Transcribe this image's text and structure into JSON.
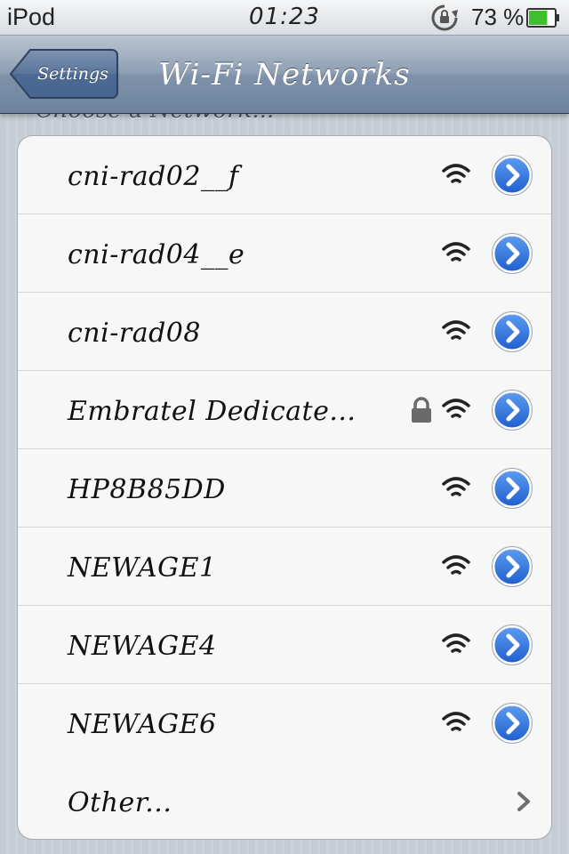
{
  "status_bar": {
    "carrier": "iPod",
    "time": "01:23",
    "battery_percent": "73 %",
    "battery_level": 0.73
  },
  "nav": {
    "back_label": "Settings",
    "title": "Wi-Fi Networks"
  },
  "section_header": "Choose a Network...",
  "networks": [
    {
      "name": "cni-rad02__f",
      "secured": false
    },
    {
      "name": "cni-rad04__e",
      "secured": false
    },
    {
      "name": "cni-rad08",
      "secured": false
    },
    {
      "name": "Embratel Dedicate...",
      "secured": true
    },
    {
      "name": "HP8B85DD",
      "secured": false
    },
    {
      "name": "NEWAGE1",
      "secured": false
    },
    {
      "name": "NEWAGE4",
      "secured": false
    },
    {
      "name": "NEWAGE6",
      "secured": false
    }
  ],
  "other_label": "Other...",
  "colors": {
    "nav_bar": "#7f92aa",
    "detail_button": "#2b6fd8",
    "battery_fill": "#3fbf2e"
  },
  "icons": {
    "rotation_lock": "rotation-lock-icon",
    "battery": "battery-icon",
    "back": "back-arrow-button",
    "wifi": "wifi-signal-icon",
    "lock": "padlock-icon",
    "detail": "detail-disclosure-icon",
    "chevron": "chevron-right-icon"
  }
}
